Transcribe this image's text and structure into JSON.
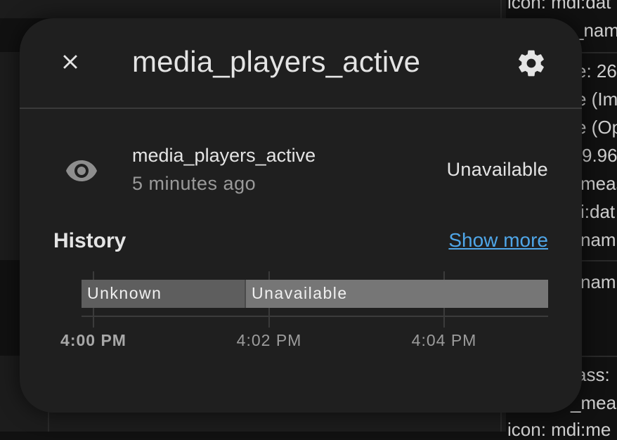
{
  "background": {
    "fragments": [
      "icon: mdi:dat",
      "_nam",
      "e: 26",
      "e (Im",
      "e (Op",
      "9.96",
      "meas",
      "i:dat",
      "nam",
      "nam",
      "ass:",
      "_meas",
      "icon: mdi:me"
    ]
  },
  "dialog": {
    "title": "media_players_active",
    "close_icon": "close-icon",
    "settings_icon": "gear-icon",
    "entity": {
      "icon": "eye-icon",
      "name": "media_players_active",
      "last_changed": "5 minutes ago",
      "state": "Unavailable"
    },
    "history": {
      "title": "History",
      "show_more": "Show more",
      "segments": [
        {
          "label": "Unknown",
          "state": "unknown"
        },
        {
          "label": "Unavailable",
          "state": "unavailable"
        }
      ],
      "ticks": [
        "4:00 PM",
        "4:02 PM",
        "4:04 PM"
      ]
    }
  },
  "colors": {
    "dialog_bg": "#1f1f1f",
    "link": "#4fa6e8",
    "unknown_bar": "#5e5e5e",
    "unavailable_bar": "#767676"
  }
}
